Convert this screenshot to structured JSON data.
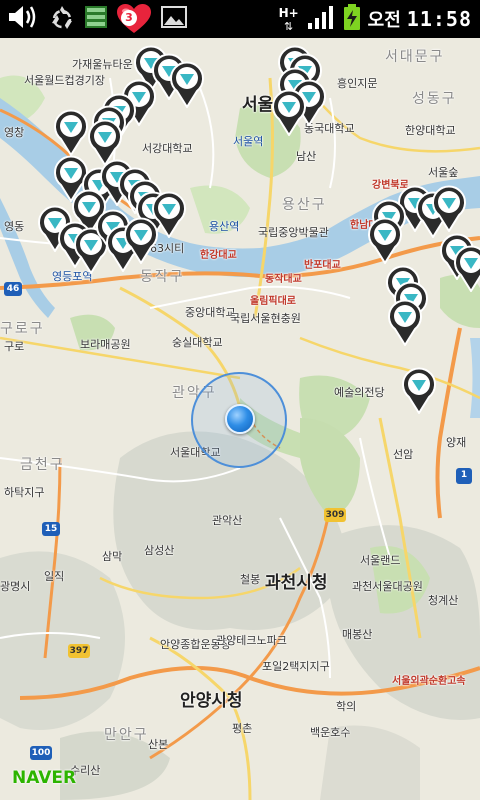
{
  "status_bar": {
    "notification_badge": "3",
    "network_type": "H+",
    "ampm": "오전",
    "time": "11:58",
    "icons": [
      "volume-icon",
      "recycle-icon",
      "list-icon",
      "heart-icon",
      "image-icon",
      "data-arrows-icon",
      "signal-icon",
      "battery-charging-icon"
    ]
  },
  "map": {
    "districts": [
      "서대문구",
      "성동구",
      "용산구",
      "동작구",
      "구로구",
      "관악구",
      "금천구",
      "만안구"
    ],
    "major_labels": [
      "서울시청",
      "과천시청",
      "안양시청"
    ],
    "places": [
      "서울월드컵경기장",
      "가재울뉴타운",
      "서울역",
      "동국대학교",
      "남산",
      "흥인지문",
      "한양대학교",
      "서강대학교",
      "용산역",
      "국립중앙박물관",
      "63시티",
      "영등포역",
      "중앙대학교",
      "국립서울현충원",
      "숭실대학교",
      "보라매공원",
      "예술의전당",
      "서울대학교",
      "양재",
      "관악산",
      "삼성산",
      "철봉",
      "서울랜드",
      "과천서울대공원",
      "청계산",
      "매봉산",
      "안양종합운동장",
      "관양테크노파크",
      "포일2택지지구",
      "백운호수",
      "수리산",
      "산본",
      "평촌",
      "광명시",
      "하탁지구",
      "일직",
      "삼막",
      "영동",
      "구로",
      "학의",
      "선암",
      "영창",
      "서울숲",
      "강변북로",
      "올림픽대로",
      "동작대교",
      "한강대교",
      "반포대교",
      "한남대교"
    ],
    "roads": [
      "올림픽대로",
      "서울외곽순환고속"
    ],
    "route_numbers": [
      "1",
      "15",
      "46",
      "309",
      "397",
      "100"
    ],
    "marker_count": 38,
    "logo": "NAVER",
    "colors": {
      "land": "#eceadf",
      "water": "#a8cde6",
      "park": "#c8dfb2",
      "mountain": "#d7d9cf",
      "expressway": "#f39a4a",
      "major_road": "#f6d66a",
      "marker": "#2b2b2b",
      "marker_accent": "#39b7c4",
      "location": "#2e8de6",
      "logo": "#2db400"
    }
  }
}
